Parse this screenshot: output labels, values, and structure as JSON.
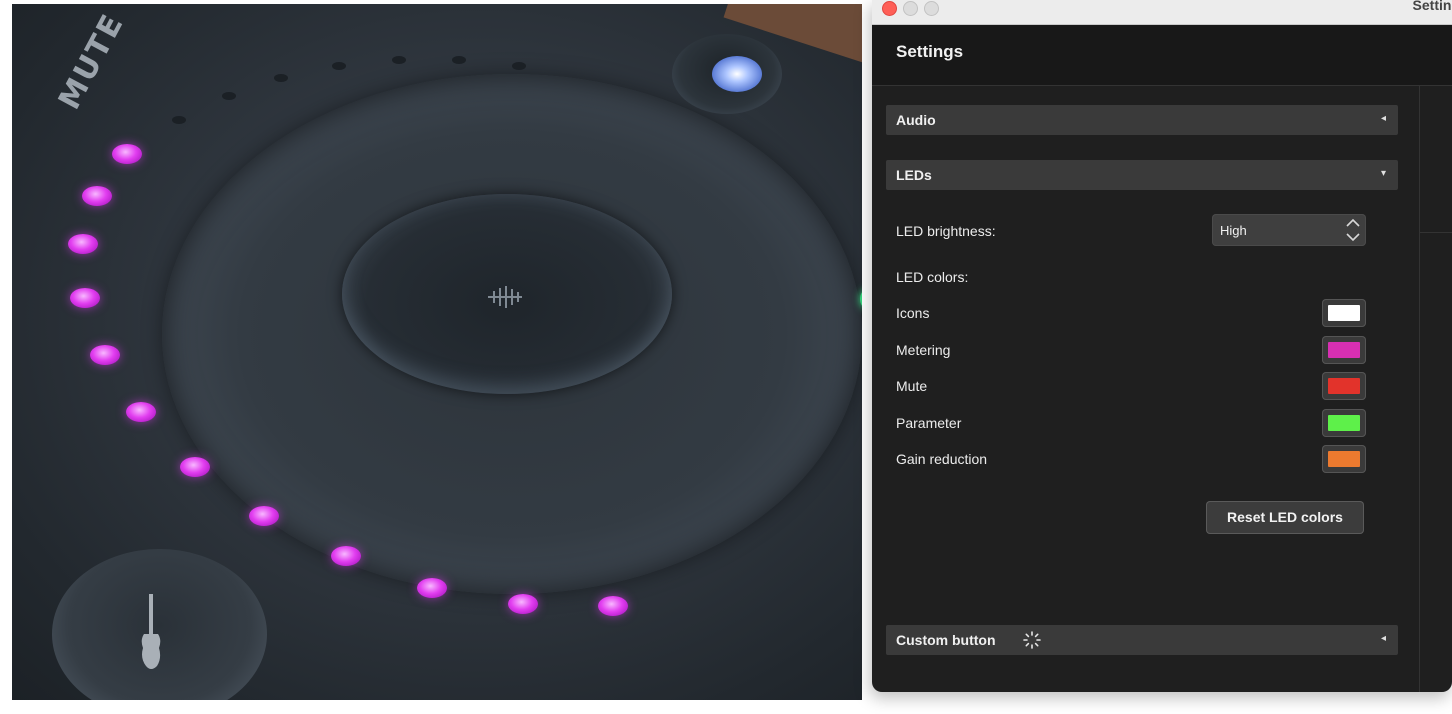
{
  "photo": {
    "engraved_text": "MUTE"
  },
  "window": {
    "title": "Setting"
  },
  "header": {
    "title": "Settings"
  },
  "sections": {
    "audio": {
      "label": "Audio",
      "state": "collapsed"
    },
    "leds": {
      "label": "LEDs",
      "state": "expanded"
    },
    "custom_button": {
      "label": "Custom button",
      "state": "collapsed",
      "icon": "spinner-icon"
    }
  },
  "leds": {
    "brightness_label": "LED brightness:",
    "brightness_value": "High",
    "colors_label": "LED colors:",
    "colors": [
      {
        "label": "Icons",
        "color": "#ffffff"
      },
      {
        "label": "Metering",
        "color": "#d72fb2"
      },
      {
        "label": "Mute",
        "color": "#e2332b"
      },
      {
        "label": "Parameter",
        "color": "#5ef04a"
      },
      {
        "label": "Gain reduction",
        "color": "#ec7a2f"
      }
    ],
    "reset_label": "Reset LED colors"
  },
  "icons": {
    "collapsed_arrow": "◂",
    "expanded_arrow": "▾"
  }
}
